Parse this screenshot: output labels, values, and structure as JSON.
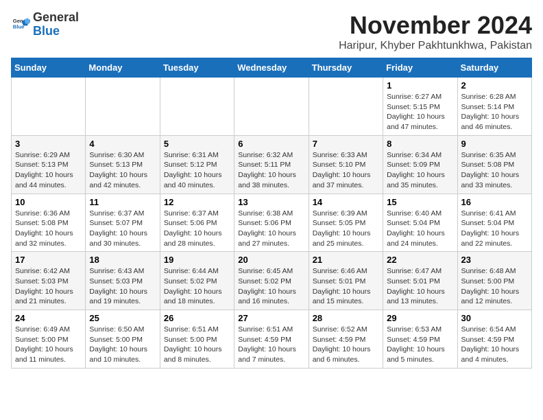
{
  "header": {
    "logo_general": "General",
    "logo_blue": "Blue",
    "month_title": "November 2024",
    "location": "Haripur, Khyber Pakhtunkhwa, Pakistan"
  },
  "weekdays": [
    "Sunday",
    "Monday",
    "Tuesday",
    "Wednesday",
    "Thursday",
    "Friday",
    "Saturday"
  ],
  "weeks": [
    [
      {
        "day": "",
        "info": ""
      },
      {
        "day": "",
        "info": ""
      },
      {
        "day": "",
        "info": ""
      },
      {
        "day": "",
        "info": ""
      },
      {
        "day": "",
        "info": ""
      },
      {
        "day": "1",
        "info": "Sunrise: 6:27 AM\nSunset: 5:15 PM\nDaylight: 10 hours and 47 minutes."
      },
      {
        "day": "2",
        "info": "Sunrise: 6:28 AM\nSunset: 5:14 PM\nDaylight: 10 hours and 46 minutes."
      }
    ],
    [
      {
        "day": "3",
        "info": "Sunrise: 6:29 AM\nSunset: 5:13 PM\nDaylight: 10 hours and 44 minutes."
      },
      {
        "day": "4",
        "info": "Sunrise: 6:30 AM\nSunset: 5:13 PM\nDaylight: 10 hours and 42 minutes."
      },
      {
        "day": "5",
        "info": "Sunrise: 6:31 AM\nSunset: 5:12 PM\nDaylight: 10 hours and 40 minutes."
      },
      {
        "day": "6",
        "info": "Sunrise: 6:32 AM\nSunset: 5:11 PM\nDaylight: 10 hours and 38 minutes."
      },
      {
        "day": "7",
        "info": "Sunrise: 6:33 AM\nSunset: 5:10 PM\nDaylight: 10 hours and 37 minutes."
      },
      {
        "day": "8",
        "info": "Sunrise: 6:34 AM\nSunset: 5:09 PM\nDaylight: 10 hours and 35 minutes."
      },
      {
        "day": "9",
        "info": "Sunrise: 6:35 AM\nSunset: 5:08 PM\nDaylight: 10 hours and 33 minutes."
      }
    ],
    [
      {
        "day": "10",
        "info": "Sunrise: 6:36 AM\nSunset: 5:08 PM\nDaylight: 10 hours and 32 minutes."
      },
      {
        "day": "11",
        "info": "Sunrise: 6:37 AM\nSunset: 5:07 PM\nDaylight: 10 hours and 30 minutes."
      },
      {
        "day": "12",
        "info": "Sunrise: 6:37 AM\nSunset: 5:06 PM\nDaylight: 10 hours and 28 minutes."
      },
      {
        "day": "13",
        "info": "Sunrise: 6:38 AM\nSunset: 5:06 PM\nDaylight: 10 hours and 27 minutes."
      },
      {
        "day": "14",
        "info": "Sunrise: 6:39 AM\nSunset: 5:05 PM\nDaylight: 10 hours and 25 minutes."
      },
      {
        "day": "15",
        "info": "Sunrise: 6:40 AM\nSunset: 5:04 PM\nDaylight: 10 hours and 24 minutes."
      },
      {
        "day": "16",
        "info": "Sunrise: 6:41 AM\nSunset: 5:04 PM\nDaylight: 10 hours and 22 minutes."
      }
    ],
    [
      {
        "day": "17",
        "info": "Sunrise: 6:42 AM\nSunset: 5:03 PM\nDaylight: 10 hours and 21 minutes."
      },
      {
        "day": "18",
        "info": "Sunrise: 6:43 AM\nSunset: 5:03 PM\nDaylight: 10 hours and 19 minutes."
      },
      {
        "day": "19",
        "info": "Sunrise: 6:44 AM\nSunset: 5:02 PM\nDaylight: 10 hours and 18 minutes."
      },
      {
        "day": "20",
        "info": "Sunrise: 6:45 AM\nSunset: 5:02 PM\nDaylight: 10 hours and 16 minutes."
      },
      {
        "day": "21",
        "info": "Sunrise: 6:46 AM\nSunset: 5:01 PM\nDaylight: 10 hours and 15 minutes."
      },
      {
        "day": "22",
        "info": "Sunrise: 6:47 AM\nSunset: 5:01 PM\nDaylight: 10 hours and 13 minutes."
      },
      {
        "day": "23",
        "info": "Sunrise: 6:48 AM\nSunset: 5:00 PM\nDaylight: 10 hours and 12 minutes."
      }
    ],
    [
      {
        "day": "24",
        "info": "Sunrise: 6:49 AM\nSunset: 5:00 PM\nDaylight: 10 hours and 11 minutes."
      },
      {
        "day": "25",
        "info": "Sunrise: 6:50 AM\nSunset: 5:00 PM\nDaylight: 10 hours and 10 minutes."
      },
      {
        "day": "26",
        "info": "Sunrise: 6:51 AM\nSunset: 5:00 PM\nDaylight: 10 hours and 8 minutes."
      },
      {
        "day": "27",
        "info": "Sunrise: 6:51 AM\nSunset: 4:59 PM\nDaylight: 10 hours and 7 minutes."
      },
      {
        "day": "28",
        "info": "Sunrise: 6:52 AM\nSunset: 4:59 PM\nDaylight: 10 hours and 6 minutes."
      },
      {
        "day": "29",
        "info": "Sunrise: 6:53 AM\nSunset: 4:59 PM\nDaylight: 10 hours and 5 minutes."
      },
      {
        "day": "30",
        "info": "Sunrise: 6:54 AM\nSunset: 4:59 PM\nDaylight: 10 hours and 4 minutes."
      }
    ]
  ]
}
